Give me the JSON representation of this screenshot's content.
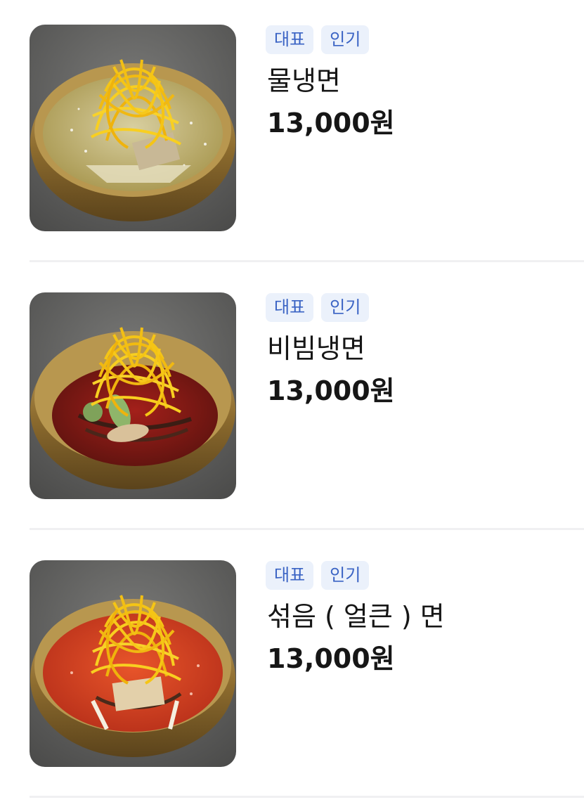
{
  "menu": {
    "items": [
      {
        "badges": [
          "대표",
          "인기"
        ],
        "name": "물냉면",
        "price": "13,000원",
        "photo_icon": "mul-naengmyeon-photo"
      },
      {
        "badges": [
          "대표",
          "인기"
        ],
        "name": "비빔냉면",
        "price": "13,000원",
        "photo_icon": "bibim-naengmyeon-photo"
      },
      {
        "badges": [
          "대표",
          "인기"
        ],
        "name": "섞음 ( 얼큰 ) 면",
        "price": "13,000원",
        "photo_icon": "spicy-mixed-naengmyeon-photo"
      }
    ]
  },
  "colors": {
    "badge_bg": "#ebf1fb",
    "badge_text": "#3a63c4",
    "text": "#161616",
    "divider": "#f0f0f2"
  }
}
